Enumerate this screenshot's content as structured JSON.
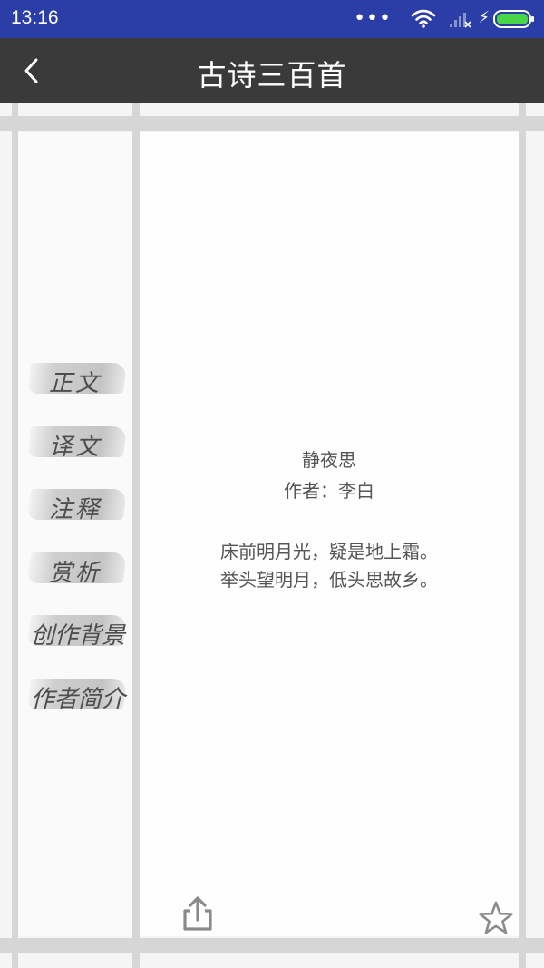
{
  "status_bar": {
    "time": "13:16",
    "icons": [
      "more-dots-icon",
      "wifi-icon",
      "signal-icon",
      "charging-bolt-icon",
      "battery-icon"
    ],
    "background": "#2b3ea8",
    "battery_color": "#46d646"
  },
  "header": {
    "title": "古诗三百首",
    "background": "#3a3a3a"
  },
  "sidebar": {
    "items": [
      {
        "label": "正文"
      },
      {
        "label": "译文"
      },
      {
        "label": "注释"
      },
      {
        "label": "赏析"
      },
      {
        "label": "创作背景"
      },
      {
        "label": "作者简介"
      }
    ]
  },
  "poem": {
    "title": "静夜思",
    "author": "作者：李白",
    "lines": [
      "床前明月光，疑是地上霜。",
      "举头望明月，低头思故乡。"
    ],
    "text_color": "#555555"
  },
  "footer": {
    "icons": [
      "share-icon",
      "star-icon"
    ]
  }
}
